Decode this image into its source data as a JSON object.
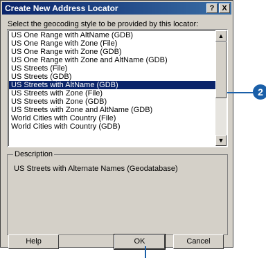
{
  "window": {
    "title": "Create New Address Locator",
    "help_glyph": "?",
    "close_glyph": "X"
  },
  "prompt": "Select the geocoding style to be provided by this locator:",
  "list": {
    "items": [
      "US One Range with AltName (GDB)",
      "US One Range with Zone (File)",
      "US One Range with Zone (GDB)",
      "US One Range with Zone and AltName (GDB)",
      "US Streets (File)",
      "US Streets (GDB)",
      "US Streets with AltName (GDB)",
      "US Streets with Zone (File)",
      "US Streets with Zone (GDB)",
      "US Streets with Zone and AltName (GDB)",
      "World Cities with Country (File)",
      "World Cities with Country (GDB)"
    ],
    "selected": "US Streets with AltName (GDB)",
    "scroll_up_glyph": "▲",
    "scroll_down_glyph": "▼"
  },
  "description": {
    "legend": "Description",
    "text": "US Streets with Alternate Names (Geodatabase)"
  },
  "buttons": {
    "help": "Help",
    "ok": "OK",
    "cancel": "Cancel"
  },
  "callout": {
    "number": "2",
    "color": "#1a5fa8"
  }
}
